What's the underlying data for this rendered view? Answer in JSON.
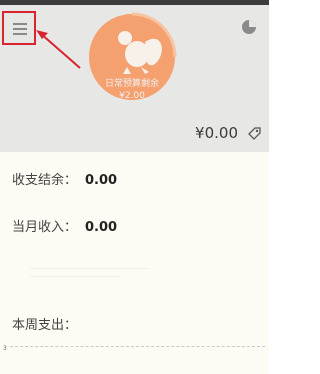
{
  "header": {
    "budget_label": "日常预算剩余",
    "budget_value": "¥2.00",
    "balance": "¥0.00"
  },
  "summary": {
    "net_label": "收支结余：",
    "net_value": "0.00",
    "income_label": "当月收入：",
    "income_value": "0.00",
    "weekly_label": "本周支出："
  },
  "chart": {
    "axis_value": "3"
  },
  "colors": {
    "accent": "#f4a06f",
    "highlight": "#d9232e",
    "header_bg": "#e7e7e5"
  }
}
